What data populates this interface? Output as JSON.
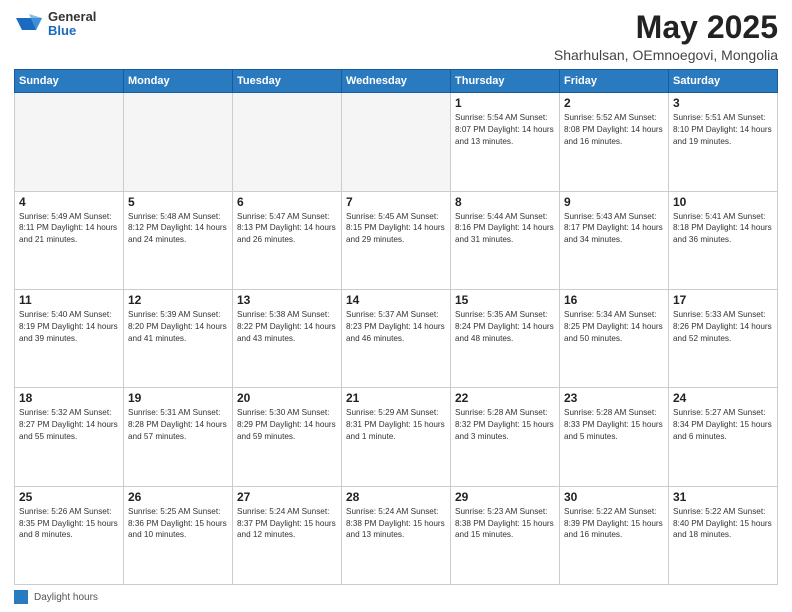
{
  "logo": {
    "general": "General",
    "blue": "Blue"
  },
  "title": "May 2025",
  "subtitle": "Sharhulsan, OEmnoegovi, Mongolia",
  "days_header": [
    "Sunday",
    "Monday",
    "Tuesday",
    "Wednesday",
    "Thursday",
    "Friday",
    "Saturday"
  ],
  "weeks": [
    [
      {
        "day": "",
        "info": ""
      },
      {
        "day": "",
        "info": ""
      },
      {
        "day": "",
        "info": ""
      },
      {
        "day": "",
        "info": ""
      },
      {
        "day": "1",
        "info": "Sunrise: 5:54 AM\nSunset: 8:07 PM\nDaylight: 14 hours\nand 13 minutes."
      },
      {
        "day": "2",
        "info": "Sunrise: 5:52 AM\nSunset: 8:08 PM\nDaylight: 14 hours\nand 16 minutes."
      },
      {
        "day": "3",
        "info": "Sunrise: 5:51 AM\nSunset: 8:10 PM\nDaylight: 14 hours\nand 19 minutes."
      }
    ],
    [
      {
        "day": "4",
        "info": "Sunrise: 5:49 AM\nSunset: 8:11 PM\nDaylight: 14 hours\nand 21 minutes."
      },
      {
        "day": "5",
        "info": "Sunrise: 5:48 AM\nSunset: 8:12 PM\nDaylight: 14 hours\nand 24 minutes."
      },
      {
        "day": "6",
        "info": "Sunrise: 5:47 AM\nSunset: 8:13 PM\nDaylight: 14 hours\nand 26 minutes."
      },
      {
        "day": "7",
        "info": "Sunrise: 5:45 AM\nSunset: 8:15 PM\nDaylight: 14 hours\nand 29 minutes."
      },
      {
        "day": "8",
        "info": "Sunrise: 5:44 AM\nSunset: 8:16 PM\nDaylight: 14 hours\nand 31 minutes."
      },
      {
        "day": "9",
        "info": "Sunrise: 5:43 AM\nSunset: 8:17 PM\nDaylight: 14 hours\nand 34 minutes."
      },
      {
        "day": "10",
        "info": "Sunrise: 5:41 AM\nSunset: 8:18 PM\nDaylight: 14 hours\nand 36 minutes."
      }
    ],
    [
      {
        "day": "11",
        "info": "Sunrise: 5:40 AM\nSunset: 8:19 PM\nDaylight: 14 hours\nand 39 minutes."
      },
      {
        "day": "12",
        "info": "Sunrise: 5:39 AM\nSunset: 8:20 PM\nDaylight: 14 hours\nand 41 minutes."
      },
      {
        "day": "13",
        "info": "Sunrise: 5:38 AM\nSunset: 8:22 PM\nDaylight: 14 hours\nand 43 minutes."
      },
      {
        "day": "14",
        "info": "Sunrise: 5:37 AM\nSunset: 8:23 PM\nDaylight: 14 hours\nand 46 minutes."
      },
      {
        "day": "15",
        "info": "Sunrise: 5:35 AM\nSunset: 8:24 PM\nDaylight: 14 hours\nand 48 minutes."
      },
      {
        "day": "16",
        "info": "Sunrise: 5:34 AM\nSunset: 8:25 PM\nDaylight: 14 hours\nand 50 minutes."
      },
      {
        "day": "17",
        "info": "Sunrise: 5:33 AM\nSunset: 8:26 PM\nDaylight: 14 hours\nand 52 minutes."
      }
    ],
    [
      {
        "day": "18",
        "info": "Sunrise: 5:32 AM\nSunset: 8:27 PM\nDaylight: 14 hours\nand 55 minutes."
      },
      {
        "day": "19",
        "info": "Sunrise: 5:31 AM\nSunset: 8:28 PM\nDaylight: 14 hours\nand 57 minutes."
      },
      {
        "day": "20",
        "info": "Sunrise: 5:30 AM\nSunset: 8:29 PM\nDaylight: 14 hours\nand 59 minutes."
      },
      {
        "day": "21",
        "info": "Sunrise: 5:29 AM\nSunset: 8:31 PM\nDaylight: 15 hours\nand 1 minute."
      },
      {
        "day": "22",
        "info": "Sunrise: 5:28 AM\nSunset: 8:32 PM\nDaylight: 15 hours\nand 3 minutes."
      },
      {
        "day": "23",
        "info": "Sunrise: 5:28 AM\nSunset: 8:33 PM\nDaylight: 15 hours\nand 5 minutes."
      },
      {
        "day": "24",
        "info": "Sunrise: 5:27 AM\nSunset: 8:34 PM\nDaylight: 15 hours\nand 6 minutes."
      }
    ],
    [
      {
        "day": "25",
        "info": "Sunrise: 5:26 AM\nSunset: 8:35 PM\nDaylight: 15 hours\nand 8 minutes."
      },
      {
        "day": "26",
        "info": "Sunrise: 5:25 AM\nSunset: 8:36 PM\nDaylight: 15 hours\nand 10 minutes."
      },
      {
        "day": "27",
        "info": "Sunrise: 5:24 AM\nSunset: 8:37 PM\nDaylight: 15 hours\nand 12 minutes."
      },
      {
        "day": "28",
        "info": "Sunrise: 5:24 AM\nSunset: 8:38 PM\nDaylight: 15 hours\nand 13 minutes."
      },
      {
        "day": "29",
        "info": "Sunrise: 5:23 AM\nSunset: 8:38 PM\nDaylight: 15 hours\nand 15 minutes."
      },
      {
        "day": "30",
        "info": "Sunrise: 5:22 AM\nSunset: 8:39 PM\nDaylight: 15 hours\nand 16 minutes."
      },
      {
        "day": "31",
        "info": "Sunrise: 5:22 AM\nSunset: 8:40 PM\nDaylight: 15 hours\nand 18 minutes."
      }
    ]
  ],
  "footer": {
    "legend_label": "Daylight hours"
  }
}
